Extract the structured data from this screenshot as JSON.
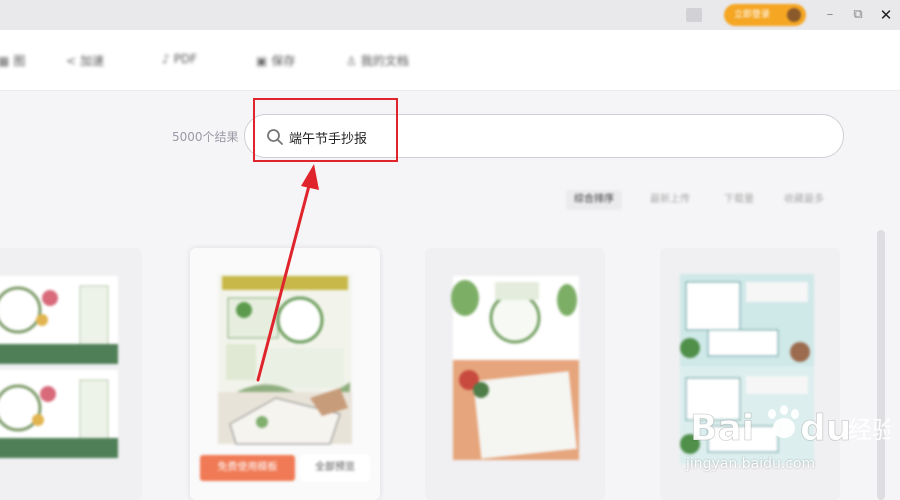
{
  "titlebar": {
    "vip_label": "立即登录",
    "controls": {
      "minimize": "–",
      "restore": "⧉",
      "close": "✕"
    }
  },
  "toolbar": {
    "items": [
      {
        "icon": "grid-icon",
        "label": "图"
      },
      {
        "icon": "compress-icon",
        "label": "加速"
      },
      {
        "icon": "pdf-icon",
        "label": "PDF"
      },
      {
        "icon": "save-icon",
        "label": "保存"
      },
      {
        "icon": "user-icon",
        "label": "我的文档"
      }
    ]
  },
  "search": {
    "results_count": "5000个结果",
    "query": "端午节手抄报"
  },
  "sort": {
    "items": [
      "综合排序",
      "最新上传",
      "下载量",
      "收藏最多"
    ],
    "active_index": 0
  },
  "cards": {
    "use_label": "免费使用模板",
    "preview_label": "全部预览"
  },
  "watermark": {
    "url": "jingyan.baidu.com",
    "logo_text": "Bai du 经验"
  },
  "colors": {
    "highlight": "#e0242b",
    "accent": "#f5a623",
    "use_button": "#f07a55"
  }
}
